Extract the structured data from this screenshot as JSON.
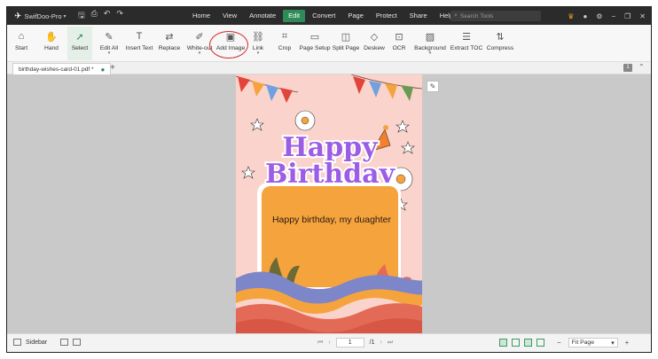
{
  "app": {
    "name": "SwifDoo-Pro"
  },
  "menu": [
    {
      "label": "Home",
      "active": false
    },
    {
      "label": "View",
      "active": false
    },
    {
      "label": "Annotate",
      "active": false
    },
    {
      "label": "Edit",
      "active": true
    },
    {
      "label": "Convert",
      "active": false
    },
    {
      "label": "Page",
      "active": false
    },
    {
      "label": "Protect",
      "active": false
    },
    {
      "label": "Share",
      "active": false
    },
    {
      "label": "Help",
      "active": false
    }
  ],
  "search": {
    "placeholder": "Search Tools"
  },
  "toolbar": [
    {
      "label": "Start",
      "icon": "home-icon",
      "glyph": "⌂"
    },
    {
      "label": "Hand",
      "icon": "hand-icon",
      "glyph": "✋"
    },
    {
      "label": "Select",
      "icon": "cursor-icon",
      "glyph": "➚",
      "selected": true
    },
    {
      "label": "Edit All",
      "icon": "edit-all-icon",
      "glyph": "✎",
      "dropdown": true
    },
    {
      "label": "Insert Text",
      "icon": "insert-text-icon",
      "glyph": "T"
    },
    {
      "label": "Replace",
      "icon": "replace-icon",
      "glyph": "⇄"
    },
    {
      "label": "White-out",
      "icon": "white-out-icon",
      "glyph": "✐",
      "dropdown": true
    },
    {
      "label": "Add Image",
      "icon": "add-image-icon",
      "glyph": "▣"
    },
    {
      "label": "Link",
      "icon": "link-icon",
      "glyph": "⛓",
      "dropdown": true
    },
    {
      "label": "Crop",
      "icon": "crop-icon",
      "glyph": "⌗"
    },
    {
      "label": "Page Setup",
      "icon": "page-setup-icon",
      "glyph": "▭"
    },
    {
      "label": "Split Page",
      "icon": "split-page-icon",
      "glyph": "◫"
    },
    {
      "label": "Deskew",
      "icon": "deskew-icon",
      "glyph": "◇"
    },
    {
      "label": "OCR",
      "icon": "ocr-icon",
      "glyph": "⊡"
    },
    {
      "label": "Background",
      "icon": "background-icon",
      "glyph": "▨",
      "dropdown": true
    },
    {
      "label": "Extract TOC",
      "icon": "extract-toc-icon",
      "glyph": "☰"
    },
    {
      "label": "Compress",
      "icon": "compress-icon",
      "glyph": "⇅"
    }
  ],
  "tab": {
    "filename": "birthday-wishes-card-01.pdf *",
    "badge": "1"
  },
  "card": {
    "title_line1": "Happy",
    "title_line2": "Birthday",
    "message": "Happy birthday, my duaghter"
  },
  "status": {
    "sidebar_label": "Sidebar",
    "current_page": "1",
    "total_pages": "/1",
    "zoom": "Fit Page"
  },
  "colors": {
    "accent": "#2e8b57",
    "titlebar": "#2b2b2b",
    "annotation": "#d8282a",
    "card_bg": "#fad3cc",
    "card_orange": "#f5a33d",
    "title_purple": "#9b5de5"
  }
}
